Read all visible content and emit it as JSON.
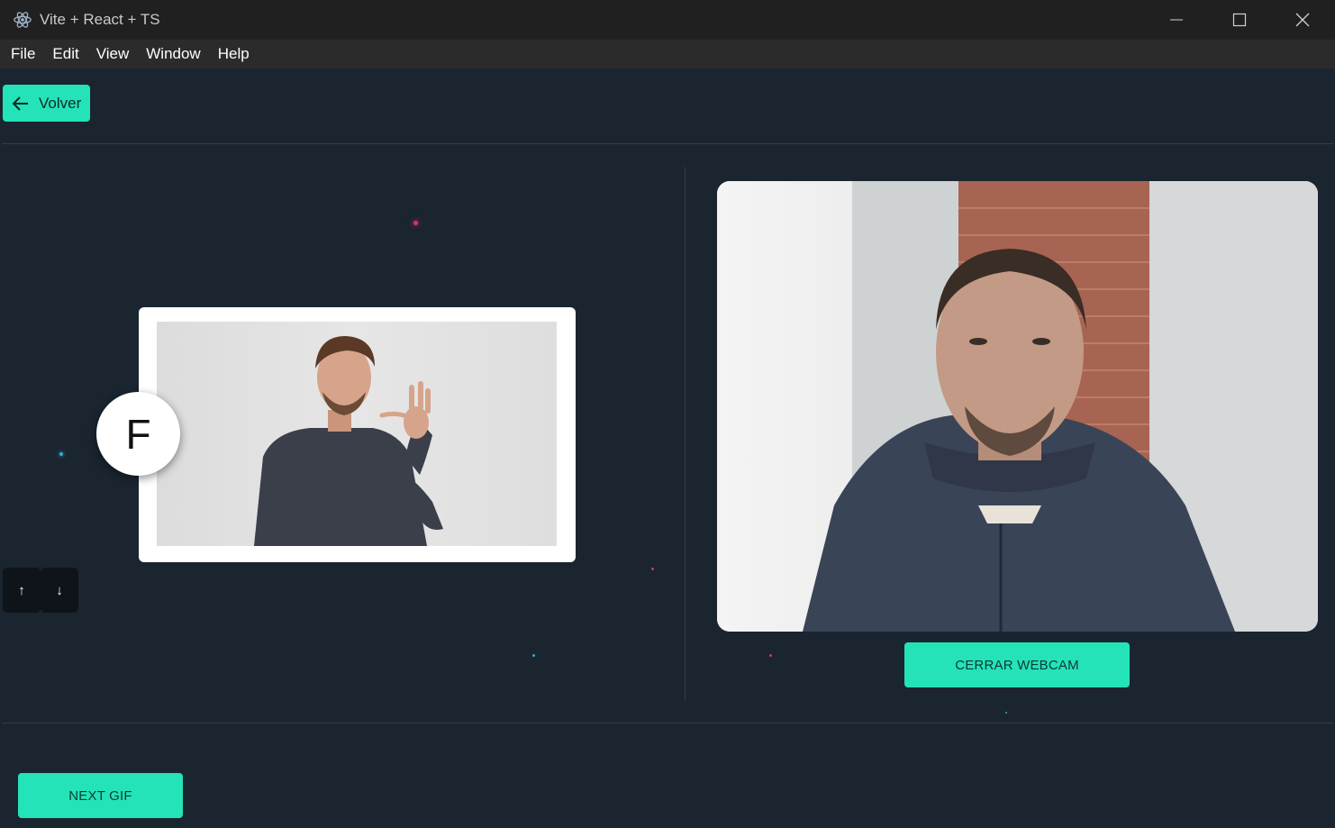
{
  "window": {
    "title": "Vite + React + TS",
    "controls": {
      "minimize": "minimize-icon",
      "maximize": "maximize-icon",
      "close": "close-icon"
    }
  },
  "menu": {
    "items": [
      {
        "label": "File"
      },
      {
        "label": "Edit"
      },
      {
        "label": "View"
      },
      {
        "label": "Window"
      },
      {
        "label": "Help"
      }
    ]
  },
  "toolbar": {
    "back_label": "Volver",
    "back_icon": "arrow-left-icon"
  },
  "sign_panel": {
    "current_letter": "F",
    "gif_description_icon": "sign-language-gif",
    "up_label": "↑",
    "down_label": "↓"
  },
  "webcam_panel": {
    "close_label": "CERRAR WEBCAM"
  },
  "footer": {
    "next_label": "NEXT GIF"
  },
  "colors": {
    "accent": "#24e3b8",
    "background": "#1a2530",
    "titlebar": "#202020",
    "menubar": "#2b2b2b"
  }
}
